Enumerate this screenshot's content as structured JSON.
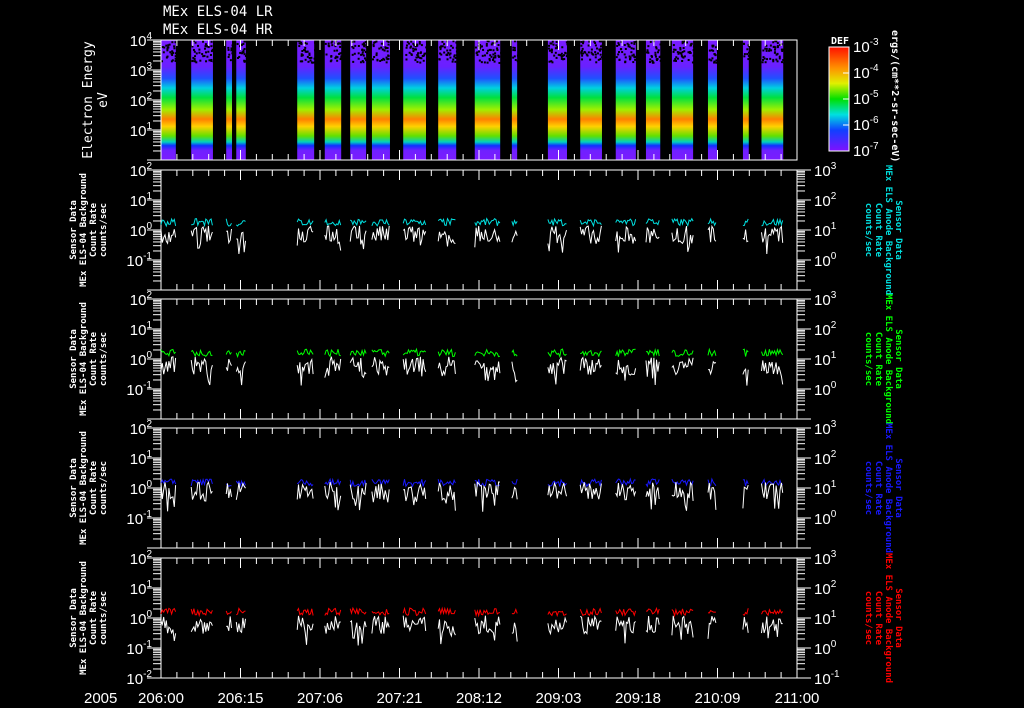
{
  "titles": [
    "MEx ELS-04 LR",
    "MEx ELS-04 HR"
  ],
  "chart_data": [
    {
      "type": "heatmap",
      "name": "spectrogram",
      "ylabel": "Electron Energy",
      "yunit": "eV",
      "yscale": "log",
      "ylim": [
        1,
        10000
      ],
      "ytick_labels": [
        "10^4",
        "10^3",
        "10^2",
        "10^1"
      ],
      "colorbar": {
        "title": "DEF",
        "label": "ergs/(cm**2-sr-sec-eV)",
        "tick_labels": [
          "10^-3",
          "10^-4",
          "10^-5",
          "10^-6",
          "10^-7"
        ],
        "range": [
          1e-07,
          0.001
        ]
      },
      "peak_energy_eV": 30
    },
    {
      "type": "line",
      "name": "panel-1",
      "color": "#00e0e0",
      "left_label": [
        "Sensor Data",
        "MEx ELS-04 Background",
        "Count Rate",
        "counts/sec"
      ],
      "right_label": [
        "Sensor Data",
        "MEx ELS Anode Background",
        "Count Rate",
        "counts/sec"
      ],
      "left_ylim": [
        0.01,
        100
      ],
      "right_ylim": [
        0.1,
        1000
      ],
      "left_ticks": [
        "10^2",
        "10^1",
        "10^0",
        "10^-1"
      ],
      "right_ticks": [
        "10^3",
        "10^2",
        "10^1",
        "10^0"
      ],
      "series": [
        {
          "name": "anode",
          "level": 1.8
        },
        {
          "name": "sensor",
          "level": 0.7
        }
      ]
    },
    {
      "type": "line",
      "name": "panel-2",
      "color": "#00ff00",
      "left_label": [
        "Sensor Data",
        "MEx ELS-04 Background",
        "Count Rate",
        "counts/sec"
      ],
      "right_label": [
        "Sensor Data",
        "MEx ELS Anode Background",
        "Count Rate",
        "counts/sec"
      ],
      "left_ylim": [
        0.01,
        100
      ],
      "right_ylim": [
        0.1,
        1000
      ],
      "left_ticks": [
        "10^2",
        "10^1",
        "10^0",
        "10^-1"
      ],
      "right_ticks": [
        "10^3",
        "10^2",
        "10^1",
        "10^0"
      ],
      "series": [
        {
          "name": "anode",
          "level": 1.6
        },
        {
          "name": "sensor",
          "level": 0.6
        }
      ]
    },
    {
      "type": "line",
      "name": "panel-3",
      "color": "#1818ff",
      "left_label": [
        "Sensor Data",
        "MEx ELS-04 Background",
        "Count Rate",
        "counts/sec"
      ],
      "right_label": [
        "Sensor Data",
        "MEx ELS Anode Background",
        "Count Rate",
        "counts/sec"
      ],
      "left_ylim": [
        0.01,
        100
      ],
      "right_ylim": [
        0.1,
        1000
      ],
      "left_ticks": [
        "10^2",
        "10^1",
        "10^0",
        "10^-1"
      ],
      "right_ticks": [
        "10^3",
        "10^2",
        "10^1",
        "10^0"
      ],
      "series": [
        {
          "name": "anode",
          "level": 1.5
        },
        {
          "name": "sensor",
          "level": 0.8
        }
      ]
    },
    {
      "type": "line",
      "name": "panel-4",
      "color": "#ff0000",
      "left_label": [
        "Sensor Data",
        "MEx ELS-04 Background",
        "Count Rate",
        "counts/sec"
      ],
      "right_label": [
        "Sensor Data",
        "MEx ELS Anode Background",
        "Count Rate",
        "counts/sec"
      ],
      "left_ylim": [
        0.01,
        100
      ],
      "right_ylim": [
        0.1,
        1000
      ],
      "left_ticks": [
        "10^2",
        "10^1",
        "10^0",
        "10^-1",
        "10^-2"
      ],
      "right_ticks": [
        "10^3",
        "10^2",
        "10^1",
        "10^0",
        "10^-1"
      ],
      "series": [
        {
          "name": "anode",
          "level": 1.6
        },
        {
          "name": "sensor",
          "level": 0.6
        }
      ]
    }
  ],
  "time_axis": {
    "year": "2005",
    "range_hours": [
      0,
      120
    ],
    "labels": [
      "206:00",
      "206:15",
      "207:06",
      "207:21",
      "208:12",
      "209:03",
      "209:18",
      "210:09",
      "211:00"
    ],
    "data_segments_hours": [
      [
        0,
        2.8
      ],
      [
        5.7,
        9.8
      ],
      [
        12.3,
        13.4
      ],
      [
        14.2,
        16.0
      ],
      [
        25.7,
        28.9
      ],
      [
        30.9,
        34.0
      ],
      [
        35.7,
        38.7
      ],
      [
        39.8,
        43.2
      ],
      [
        45.7,
        50.0
      ],
      [
        52.3,
        55.7
      ],
      [
        59.2,
        64.0
      ],
      [
        66.2,
        67.2
      ],
      [
        73.0,
        76.6
      ],
      [
        79.1,
        83.2
      ],
      [
        85.8,
        89.6
      ],
      [
        91.5,
        94.2
      ],
      [
        96.4,
        100.4
      ],
      [
        103.2,
        104.9
      ],
      [
        109.8,
        110.9
      ],
      [
        113.3,
        117.4
      ]
    ]
  }
}
